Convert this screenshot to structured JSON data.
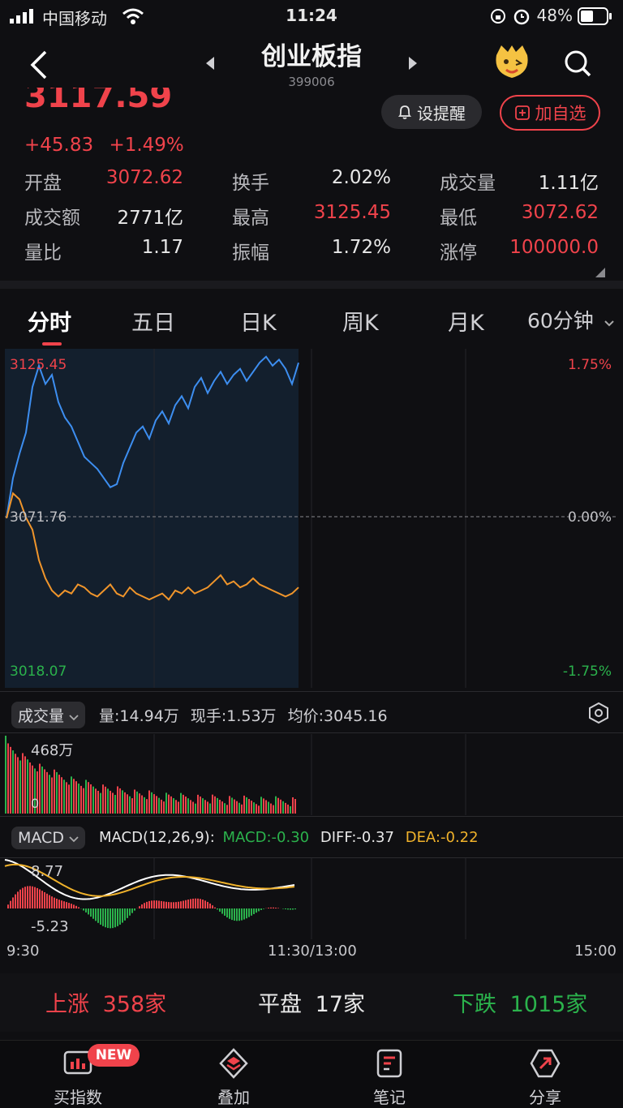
{
  "status": {
    "carrier": "中国移动",
    "time": "11:24",
    "battery": "48%"
  },
  "header": {
    "title": "创业板指",
    "code": "399006"
  },
  "quote": {
    "price": "3117.59",
    "change": "+45.83",
    "change_pct": "+1.49%",
    "alert_label": "设提醒",
    "watch_label": "加自选"
  },
  "stats": [
    {
      "label": "开盘",
      "value": "3072.62",
      "color": "#f0434b"
    },
    {
      "label": "换手",
      "value": "2.02%",
      "color": "#e8e8e8"
    },
    {
      "label": "成交量",
      "value": "1.11亿",
      "color": "#e8e8e8"
    },
    {
      "label": "成交额",
      "value": "2771亿",
      "color": "#e8e8e8"
    },
    {
      "label": "最高",
      "value": "3125.45",
      "color": "#f0434b"
    },
    {
      "label": "最低",
      "value": "3072.62",
      "color": "#f0434b"
    },
    {
      "label": "量比",
      "value": "1.17",
      "color": "#e8e8e8"
    },
    {
      "label": "振幅",
      "value": "1.72%",
      "color": "#e8e8e8"
    },
    {
      "label": "涨停",
      "value": "100000.0",
      "color": "#f0434b"
    }
  ],
  "tabs": [
    "分时",
    "五日",
    "日K",
    "周K",
    "月K",
    "60分钟"
  ],
  "chart": {
    "y_high": "3125.45",
    "y_mid": "3071.76",
    "y_low": "3018.07",
    "pct_high": "1.75%",
    "pct_mid": "0.00%",
    "pct_low": "-1.75%"
  },
  "chart_data": {
    "type": "line",
    "series": [
      {
        "name": "",
        "color": "#3d8ef0",
        "values": [
          3071.8,
          3085,
          3093,
          3100,
          3115,
          3122,
          3116,
          3119,
          3110,
          3105,
          3102,
          3097,
          3092,
          3090,
          3088,
          3085,
          3082,
          3083,
          3090,
          3095,
          3100,
          3102,
          3098,
          3104,
          3107,
          3103,
          3109,
          3112,
          3108,
          3115,
          3118,
          3113,
          3117,
          3120,
          3116,
          3119,
          3121,
          3117,
          3120,
          3123,
          3125,
          3122,
          3124,
          3121,
          3116,
          3123
        ]
      },
      {
        "name": "",
        "color": "#f0952b",
        "values": [
          3071.8,
          3080,
          3078,
          3072,
          3068,
          3058,
          3052,
          3048,
          3046,
          3048,
          3047,
          3050,
          3049,
          3047,
          3046,
          3048,
          3050,
          3047,
          3046,
          3049,
          3047,
          3046,
          3045,
          3046,
          3047,
          3045,
          3048,
          3047,
          3049,
          3047,
          3048,
          3049,
          3051,
          3053,
          3050,
          3051,
          3049,
          3050,
          3052,
          3050,
          3049,
          3048,
          3047,
          3046,
          3047,
          3049
        ]
      }
    ],
    "ylim": [
      3018.07,
      3125.45
    ]
  },
  "volume": {
    "label": "成交量",
    "info_qty": "量:14.94万",
    "info_hand": "现手:1.53万",
    "info_avg": "均价:3045.16",
    "max_label": "468万",
    "zero_label": "0"
  },
  "macd": {
    "label": "MACD",
    "params": "MACD(12,26,9):",
    "macd_val": "MACD:-0.30",
    "diff_val": "DIFF:-0.37",
    "dea_val": "DEA:-0.22",
    "top_label": "8.77",
    "bottom_label": "-5.23"
  },
  "time_axis": {
    "start": "9:30",
    "mid": "11:30/13:00",
    "end": "15:00"
  },
  "breadth": {
    "up_label": "上涨",
    "up_count": "358家",
    "flat_label": "平盘",
    "flat_count": "17家",
    "down_label": "下跌",
    "down_count": "1015家"
  },
  "tabbar": {
    "items": [
      "买指数",
      "叠加",
      "笔记",
      "分享"
    ],
    "badge": "NEW"
  }
}
